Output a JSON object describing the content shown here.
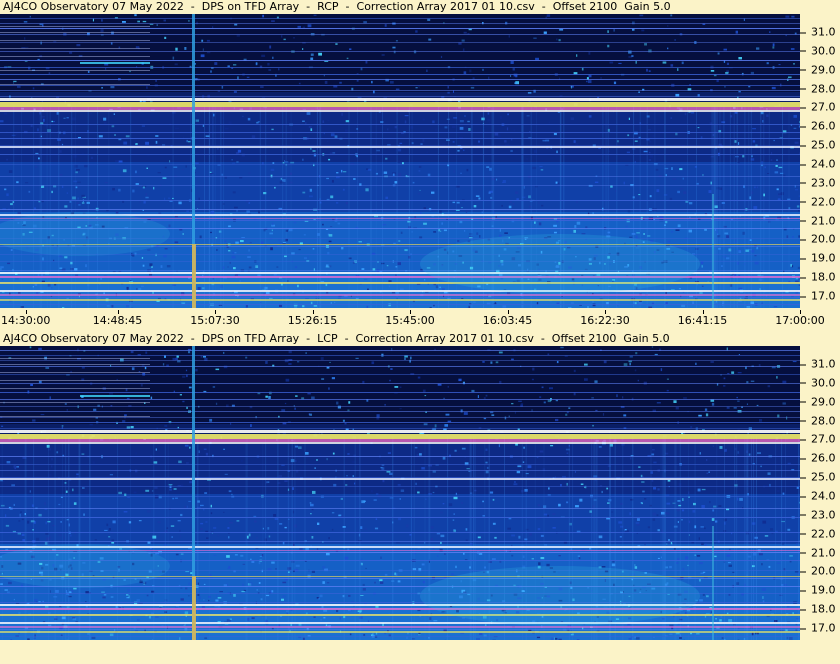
{
  "panels": [
    {
      "id": "rcp",
      "title": "AJ4CO Observatory 07 May 2022  -  DPS on TFD Array  -  RCP  -  Correction Array 2017 01 10.csv  -  Offset 2100  Gain 5.0",
      "frequencies": [
        "31.0",
        "30.0",
        "29.0",
        "28.0",
        "27.0",
        "26.0",
        "25.0",
        "24.0",
        "23.0",
        "22.0",
        "21.0",
        "20.0",
        "19.0",
        "18.0",
        "17.0"
      ],
      "times": [
        "14:30:00",
        "14:48:45",
        "15:07:30",
        "15:26:15",
        "15:45:00",
        "16:03:45",
        "16:22:30",
        "16:41:15",
        "17:00:00"
      ]
    },
    {
      "id": "lcp",
      "title": "AJ4CO Observatory 07 May 2022  -  DPS on TFD Array  -  LCP  -  Correction Array 2017 01 10.csv  -  Offset 2100  Gain 5.0",
      "frequencies": [
        "31.0",
        "30.0",
        "29.0",
        "28.0",
        "27.0",
        "26.0",
        "25.0",
        "24.0",
        "23.0",
        "22.0",
        "21.0",
        "20.0",
        "19.0",
        "18.0",
        "17.0"
      ],
      "times": []
    }
  ],
  "colors": {
    "background": "#fbf3c8",
    "deep": "#0a1a5a",
    "mid": "#1550c0",
    "bright": "#2aa8ff",
    "hot": "#e8e070"
  }
}
